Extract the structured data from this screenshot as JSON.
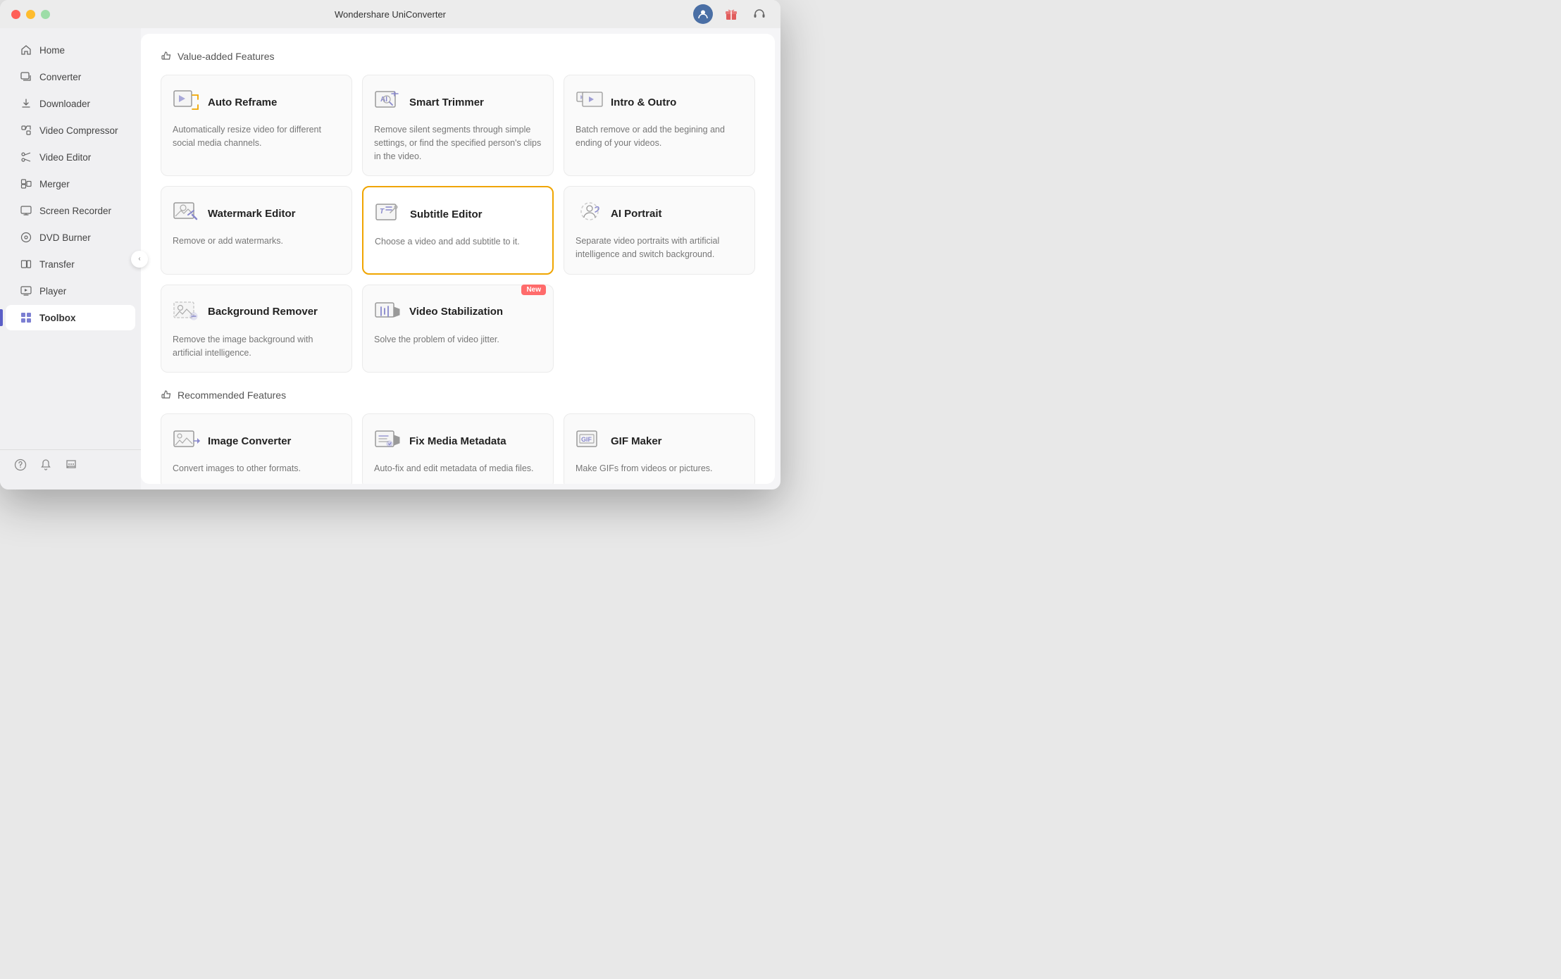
{
  "window": {
    "title": "Wondershare UniConverter"
  },
  "titlebar": {
    "title": "Wondershare UniConverter",
    "actions": {
      "user_icon": "👤",
      "gift_icon": "🎁",
      "headset_icon": "🎧"
    }
  },
  "sidebar": {
    "items": [
      {
        "id": "home",
        "label": "Home",
        "icon": "home"
      },
      {
        "id": "converter",
        "label": "Converter",
        "icon": "converter"
      },
      {
        "id": "downloader",
        "label": "Downloader",
        "icon": "downloader"
      },
      {
        "id": "video-compressor",
        "label": "Video Compressor",
        "icon": "compress"
      },
      {
        "id": "video-editor",
        "label": "Video Editor",
        "icon": "scissors"
      },
      {
        "id": "merger",
        "label": "Merger",
        "icon": "merger"
      },
      {
        "id": "screen-recorder",
        "label": "Screen Recorder",
        "icon": "screen"
      },
      {
        "id": "dvd-burner",
        "label": "DVD Burner",
        "icon": "dvd"
      },
      {
        "id": "transfer",
        "label": "Transfer",
        "icon": "transfer"
      },
      {
        "id": "player",
        "label": "Player",
        "icon": "player"
      },
      {
        "id": "toolbox",
        "label": "Toolbox",
        "icon": "toolbox",
        "active": true
      }
    ],
    "footer": {
      "help": "?",
      "bell": "🔔",
      "feedback": "💬"
    }
  },
  "content": {
    "value_added_section": {
      "header": "Value-added Features",
      "features": [
        {
          "id": "auto-reframe",
          "title": "Auto Reframe",
          "description": "Automatically resize video for different social media channels.",
          "selected": false,
          "new": false
        },
        {
          "id": "smart-trimmer",
          "title": "Smart Trimmer",
          "description": "Remove silent segments through simple settings, or find the specified person's clips in the video.",
          "selected": false,
          "new": false
        },
        {
          "id": "intro-outro",
          "title": "Intro & Outro",
          "description": "Batch remove or add the begining and ending of your videos.",
          "selected": false,
          "new": false
        },
        {
          "id": "watermark-editor",
          "title": "Watermark Editor",
          "description": "Remove or add watermarks.",
          "selected": false,
          "new": false
        },
        {
          "id": "subtitle-editor",
          "title": "Subtitle Editor",
          "description": "Choose a video and add subtitle to it.",
          "selected": true,
          "new": false
        },
        {
          "id": "ai-portrait",
          "title": "AI Portrait",
          "description": "Separate video portraits with artificial intelligence and switch background.",
          "selected": false,
          "new": false
        },
        {
          "id": "background-remover",
          "title": "Background Remover",
          "description": "Remove the image background with artificial intelligence.",
          "selected": false,
          "new": false
        },
        {
          "id": "video-stabilization",
          "title": "Video Stabilization",
          "description": "Solve the problem of video jitter.",
          "selected": false,
          "new": true
        }
      ]
    },
    "recommended_section": {
      "header": "Recommended Features",
      "features": [
        {
          "id": "image-converter",
          "title": "Image Converter",
          "description": "Convert images to other formats.",
          "selected": false,
          "new": false
        },
        {
          "id": "fix-media-metadata",
          "title": "Fix Media Metadata",
          "description": "Auto-fix and edit metadata of media files.",
          "selected": false,
          "new": false
        },
        {
          "id": "gif-maker",
          "title": "GIF Maker",
          "description": "Make GIFs from videos or pictures.",
          "selected": false,
          "new": false
        }
      ]
    }
  }
}
